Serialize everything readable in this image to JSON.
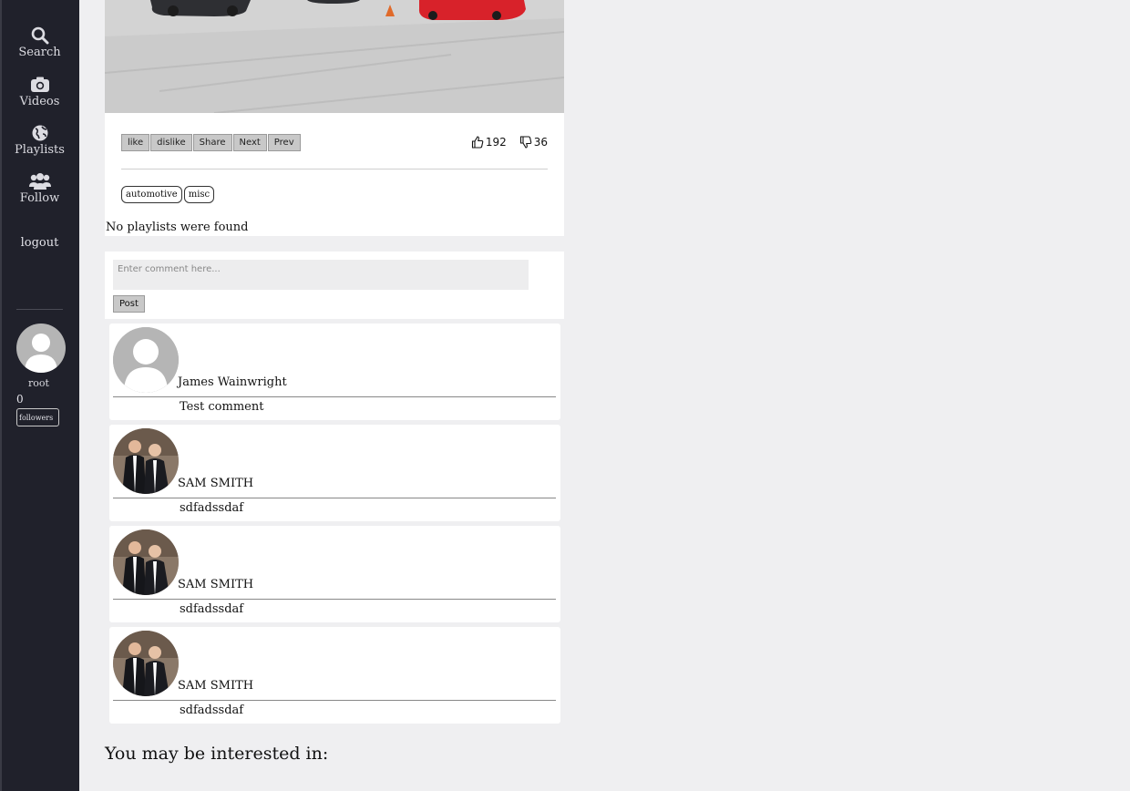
{
  "sidebar": {
    "nav": [
      {
        "label": "Search",
        "icon": "search-icon"
      },
      {
        "label": "Videos",
        "icon": "camera-icon"
      },
      {
        "label": "Playlists",
        "icon": "globe-icon"
      },
      {
        "label": "Follow",
        "icon": "users-icon"
      }
    ],
    "logout": "logout",
    "user": {
      "name": "root",
      "follower_count": "0",
      "followers_label": "followers"
    }
  },
  "video": {
    "controls": [
      "like",
      "dislike",
      "Share",
      "Next",
      "Prev"
    ],
    "likes": "192",
    "dislikes": "36",
    "tags": [
      "automotive",
      "misc"
    ],
    "no_playlists": "No playlists were found"
  },
  "comment_form": {
    "placeholder": "Enter comment here...",
    "post_label": "Post"
  },
  "comments": [
    {
      "author": "James Wainwright",
      "text": "Test comment",
      "avatar": "default"
    },
    {
      "author": "SAM SMITH",
      "text": "sdfadssdaf",
      "avatar": "photo"
    },
    {
      "author": "SAM SMITH",
      "text": "sdfadssdaf",
      "avatar": "photo"
    },
    {
      "author": "SAM SMITH",
      "text": "sdfadssdaf",
      "avatar": "photo"
    }
  ],
  "interested_heading": "You may be interested in:",
  "colors": {
    "sidebar": "#20212b",
    "background": "#efeff1",
    "button": "#c8c8c8"
  }
}
